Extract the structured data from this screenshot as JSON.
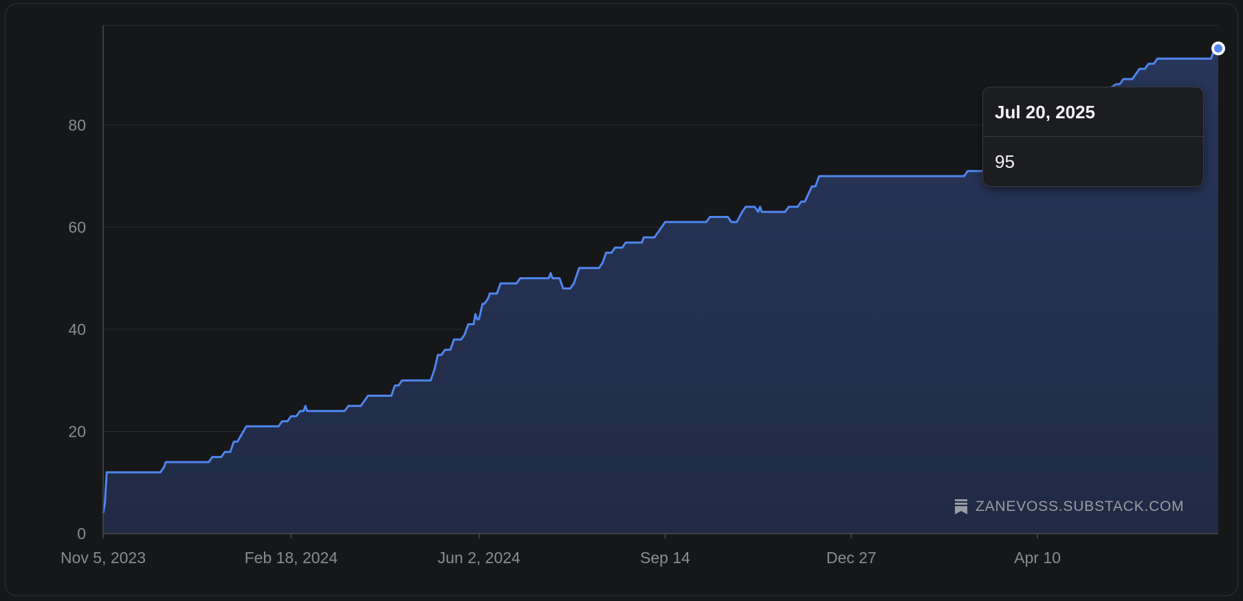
{
  "colors": {
    "line": "#4f86f0",
    "area_top": "#28365a",
    "area_bottom": "#202a44",
    "grid": "#2a2b2e",
    "axis": "#4a4b50",
    "tick_text": "#8a8c91",
    "background": "#161719"
  },
  "tooltip": {
    "date": "Jul 20, 2025",
    "value": "95"
  },
  "watermark": {
    "icon": "substack-logo-icon",
    "text": "ZANEVOSS.SUBSTACK.COM"
  },
  "chart_data": {
    "type": "area",
    "title": "",
    "xlabel": "",
    "ylabel": "",
    "grid": true,
    "ylim": [
      0,
      99.5
    ],
    "xlim": [
      "2023-11-05",
      "2025-07-20"
    ],
    "y_ticks": [
      0,
      20,
      40,
      60,
      80
    ],
    "x_ticks": [
      {
        "date": "2023-11-05",
        "label": "Nov 5, 2023"
      },
      {
        "date": "2024-02-18",
        "label": "Feb 18, 2024"
      },
      {
        "date": "2024-06-02",
        "label": "Jun 2, 2024"
      },
      {
        "date": "2024-09-14",
        "label": "Sep 14"
      },
      {
        "date": "2024-12-27",
        "label": "Dec 27"
      },
      {
        "date": "2025-04-10",
        "label": "Apr 10"
      }
    ],
    "series": [
      {
        "points": [
          [
            "2023-11-05",
            4
          ],
          [
            "2023-11-06",
            6
          ],
          [
            "2023-11-07",
            12
          ],
          [
            "2023-12-07",
            12
          ],
          [
            "2023-12-09",
            13
          ],
          [
            "2023-12-10",
            14
          ],
          [
            "2024-01-03",
            14
          ],
          [
            "2024-01-05",
            15
          ],
          [
            "2024-01-10",
            15
          ],
          [
            "2024-01-12",
            16
          ],
          [
            "2024-01-15",
            16
          ],
          [
            "2024-01-17",
            18
          ],
          [
            "2024-01-19",
            18
          ],
          [
            "2024-01-24",
            21
          ],
          [
            "2024-02-11",
            21
          ],
          [
            "2024-02-13",
            22
          ],
          [
            "2024-02-16",
            22
          ],
          [
            "2024-02-18",
            23
          ],
          [
            "2024-02-21",
            23
          ],
          [
            "2024-02-23",
            24
          ],
          [
            "2024-02-25",
            24
          ],
          [
            "2024-02-26",
            25
          ],
          [
            "2024-02-27",
            24
          ],
          [
            "2024-03-19",
            24
          ],
          [
            "2024-03-21",
            25
          ],
          [
            "2024-03-28",
            25
          ],
          [
            "2024-03-30",
            26
          ],
          [
            "2024-04-01",
            27
          ],
          [
            "2024-04-14",
            27
          ],
          [
            "2024-04-16",
            29
          ],
          [
            "2024-04-18",
            29
          ],
          [
            "2024-04-20",
            30
          ],
          [
            "2024-05-06",
            30
          ],
          [
            "2024-05-08",
            32
          ],
          [
            "2024-05-10",
            35
          ],
          [
            "2024-05-12",
            35
          ],
          [
            "2024-05-14",
            36
          ],
          [
            "2024-05-17",
            36
          ],
          [
            "2024-05-19",
            38
          ],
          [
            "2024-05-23",
            38
          ],
          [
            "2024-05-25",
            39
          ],
          [
            "2024-05-27",
            41
          ],
          [
            "2024-05-30",
            41
          ],
          [
            "2024-05-31",
            43
          ],
          [
            "2024-06-01",
            42
          ],
          [
            "2024-06-02",
            42
          ],
          [
            "2024-06-04",
            45
          ],
          [
            "2024-06-05",
            45
          ],
          [
            "2024-06-07",
            46
          ],
          [
            "2024-06-08",
            47
          ],
          [
            "2024-06-12",
            47
          ],
          [
            "2024-06-14",
            49
          ],
          [
            "2024-06-23",
            49
          ],
          [
            "2024-06-25",
            50
          ],
          [
            "2024-07-11",
            50
          ],
          [
            "2024-07-12",
            51
          ],
          [
            "2024-07-13",
            50
          ],
          [
            "2024-07-17",
            50
          ],
          [
            "2024-07-19",
            48
          ],
          [
            "2024-07-23",
            48
          ],
          [
            "2024-07-25",
            49
          ],
          [
            "2024-07-26",
            50
          ],
          [
            "2024-07-28",
            52
          ],
          [
            "2024-08-08",
            52
          ],
          [
            "2024-08-10",
            53
          ],
          [
            "2024-08-12",
            55
          ],
          [
            "2024-08-15",
            55
          ],
          [
            "2024-08-17",
            56
          ],
          [
            "2024-08-21",
            56
          ],
          [
            "2024-08-23",
            57
          ],
          [
            "2024-09-01",
            57
          ],
          [
            "2024-09-02",
            58
          ],
          [
            "2024-09-08",
            58
          ],
          [
            "2024-09-10",
            59
          ],
          [
            "2024-09-12",
            60
          ],
          [
            "2024-09-14",
            61
          ],
          [
            "2024-10-07",
            61
          ],
          [
            "2024-10-09",
            62
          ],
          [
            "2024-10-19",
            62
          ],
          [
            "2024-10-21",
            61
          ],
          [
            "2024-10-24",
            61
          ],
          [
            "2024-10-27",
            63
          ],
          [
            "2024-10-29",
            64
          ],
          [
            "2024-11-03",
            64
          ],
          [
            "2024-11-05",
            63
          ],
          [
            "2024-11-06",
            64
          ],
          [
            "2024-11-07",
            63
          ],
          [
            "2024-11-20",
            63
          ],
          [
            "2024-11-22",
            64
          ],
          [
            "2024-11-27",
            64
          ],
          [
            "2024-11-29",
            65
          ],
          [
            "2024-12-01",
            65
          ],
          [
            "2024-12-05",
            68
          ],
          [
            "2024-12-07",
            68
          ],
          [
            "2024-12-09",
            70
          ],
          [
            "2025-02-28",
            70
          ],
          [
            "2025-03-02",
            71
          ],
          [
            "2025-03-08",
            71
          ],
          [
            "2025-03-12",
            71
          ],
          [
            "2025-03-20",
            73
          ],
          [
            "2025-04-01",
            76
          ],
          [
            "2025-04-10",
            79
          ],
          [
            "2025-04-25",
            82
          ],
          [
            "2025-05-15",
            86
          ],
          [
            "2025-05-24",
            88
          ],
          [
            "2025-05-26",
            88
          ],
          [
            "2025-05-28",
            89
          ],
          [
            "2025-06-02",
            89
          ],
          [
            "2025-06-04",
            90
          ],
          [
            "2025-06-06",
            91
          ],
          [
            "2025-06-09",
            91
          ],
          [
            "2025-06-11",
            92
          ],
          [
            "2025-06-14",
            92
          ],
          [
            "2025-06-16",
            93
          ],
          [
            "2025-07-16",
            93
          ],
          [
            "2025-07-18",
            95
          ],
          [
            "2025-07-20",
            95
          ]
        ]
      }
    ],
    "highlight": {
      "date": "2025-07-20",
      "value": 95
    }
  }
}
